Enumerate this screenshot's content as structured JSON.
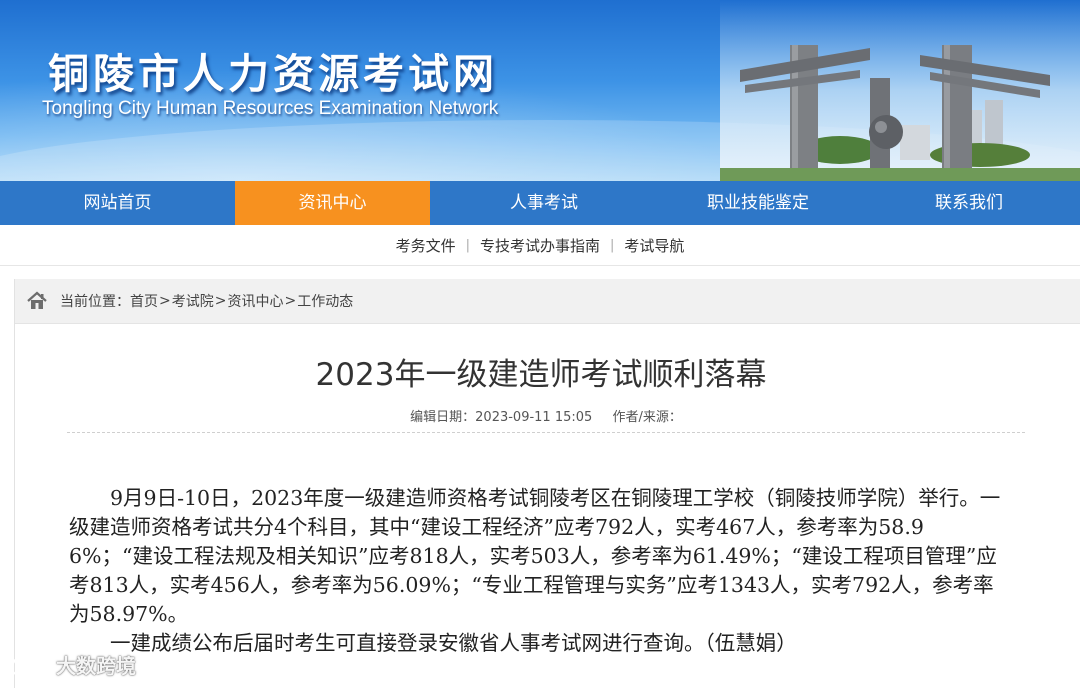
{
  "header": {
    "site_title": "铜陵市人力资源考试网",
    "site_subtitle": "Tongling City Human Resources Examination Network"
  },
  "main_nav": [
    {
      "label": "网站首页",
      "active": false
    },
    {
      "label": "资讯中心",
      "active": true
    },
    {
      "label": "人事考试",
      "active": false
    },
    {
      "label": "职业技能鉴定",
      "active": false
    },
    {
      "label": "联系我们",
      "active": false
    }
  ],
  "sub_nav": [
    "考务文件",
    "专技考试办事指南",
    "考试导航"
  ],
  "breadcrumb": {
    "prefix": "当前位置：",
    "items": [
      "首页",
      "考试院",
      "资讯中心",
      "工作动态"
    ],
    "separator": ">"
  },
  "article": {
    "title": "2023年一级建造师考试顺利落幕",
    "date_label": "编辑日期：2023-09-11 15:05",
    "author_label": "作者/来源：",
    "paragraphs": [
      "9月9日-10日，2023年度一级建造师资格考试铜陵考区在铜陵理工学校（铜陵技师学院）举行。一级建造师资格考试共分4个科目，其中“建设工程经济”应考792人，实考467人，参考率为58.96%；“建设工程法规及相关知识”应考818人，实考503人，参考率为61.49%；“建设工程项目管理”应考813人，实考456人，参考率为56.09%；“专业工程管理与实务”应考1343人，实考792人，参考率为58.97%。",
      "一建成绩公布后届时考生可直接登录安徽省人事考试网进行查询。（伍慧娟）"
    ]
  },
  "watermark": {
    "text": "大数跨境",
    "icon": "logo-mark-icon"
  },
  "colors": {
    "nav_bg": "#2e77c8",
    "nav_active": "#f7911f",
    "banner_top": "#1f6fd0"
  }
}
